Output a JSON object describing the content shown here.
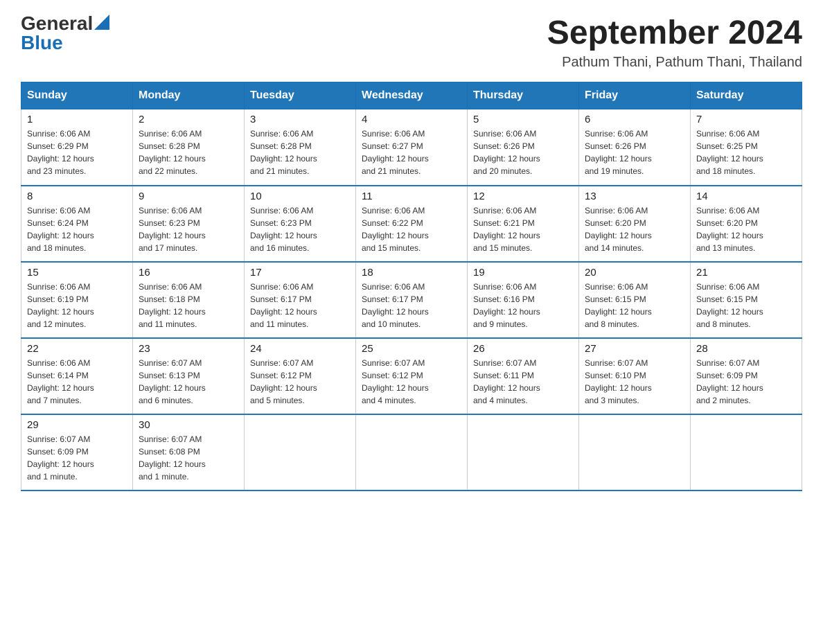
{
  "header": {
    "logo_general": "General",
    "logo_blue": "Blue",
    "month_year": "September 2024",
    "location": "Pathum Thani, Pathum Thani, Thailand"
  },
  "days_of_week": [
    "Sunday",
    "Monday",
    "Tuesday",
    "Wednesday",
    "Thursday",
    "Friday",
    "Saturday"
  ],
  "weeks": [
    [
      {
        "day": "1",
        "sunrise": "6:06 AM",
        "sunset": "6:29 PM",
        "daylight": "12 hours and 23 minutes."
      },
      {
        "day": "2",
        "sunrise": "6:06 AM",
        "sunset": "6:28 PM",
        "daylight": "12 hours and 22 minutes."
      },
      {
        "day": "3",
        "sunrise": "6:06 AM",
        "sunset": "6:28 PM",
        "daylight": "12 hours and 21 minutes."
      },
      {
        "day": "4",
        "sunrise": "6:06 AM",
        "sunset": "6:27 PM",
        "daylight": "12 hours and 21 minutes."
      },
      {
        "day": "5",
        "sunrise": "6:06 AM",
        "sunset": "6:26 PM",
        "daylight": "12 hours and 20 minutes."
      },
      {
        "day": "6",
        "sunrise": "6:06 AM",
        "sunset": "6:26 PM",
        "daylight": "12 hours and 19 minutes."
      },
      {
        "day": "7",
        "sunrise": "6:06 AM",
        "sunset": "6:25 PM",
        "daylight": "12 hours and 18 minutes."
      }
    ],
    [
      {
        "day": "8",
        "sunrise": "6:06 AM",
        "sunset": "6:24 PM",
        "daylight": "12 hours and 18 minutes."
      },
      {
        "day": "9",
        "sunrise": "6:06 AM",
        "sunset": "6:23 PM",
        "daylight": "12 hours and 17 minutes."
      },
      {
        "day": "10",
        "sunrise": "6:06 AM",
        "sunset": "6:23 PM",
        "daylight": "12 hours and 16 minutes."
      },
      {
        "day": "11",
        "sunrise": "6:06 AM",
        "sunset": "6:22 PM",
        "daylight": "12 hours and 15 minutes."
      },
      {
        "day": "12",
        "sunrise": "6:06 AM",
        "sunset": "6:21 PM",
        "daylight": "12 hours and 15 minutes."
      },
      {
        "day": "13",
        "sunrise": "6:06 AM",
        "sunset": "6:20 PM",
        "daylight": "12 hours and 14 minutes."
      },
      {
        "day": "14",
        "sunrise": "6:06 AM",
        "sunset": "6:20 PM",
        "daylight": "12 hours and 13 minutes."
      }
    ],
    [
      {
        "day": "15",
        "sunrise": "6:06 AM",
        "sunset": "6:19 PM",
        "daylight": "12 hours and 12 minutes."
      },
      {
        "day": "16",
        "sunrise": "6:06 AM",
        "sunset": "6:18 PM",
        "daylight": "12 hours and 11 minutes."
      },
      {
        "day": "17",
        "sunrise": "6:06 AM",
        "sunset": "6:17 PM",
        "daylight": "12 hours and 11 minutes."
      },
      {
        "day": "18",
        "sunrise": "6:06 AM",
        "sunset": "6:17 PM",
        "daylight": "12 hours and 10 minutes."
      },
      {
        "day": "19",
        "sunrise": "6:06 AM",
        "sunset": "6:16 PM",
        "daylight": "12 hours and 9 minutes."
      },
      {
        "day": "20",
        "sunrise": "6:06 AM",
        "sunset": "6:15 PM",
        "daylight": "12 hours and 8 minutes."
      },
      {
        "day": "21",
        "sunrise": "6:06 AM",
        "sunset": "6:15 PM",
        "daylight": "12 hours and 8 minutes."
      }
    ],
    [
      {
        "day": "22",
        "sunrise": "6:06 AM",
        "sunset": "6:14 PM",
        "daylight": "12 hours and 7 minutes."
      },
      {
        "day": "23",
        "sunrise": "6:07 AM",
        "sunset": "6:13 PM",
        "daylight": "12 hours and 6 minutes."
      },
      {
        "day": "24",
        "sunrise": "6:07 AM",
        "sunset": "6:12 PM",
        "daylight": "12 hours and 5 minutes."
      },
      {
        "day": "25",
        "sunrise": "6:07 AM",
        "sunset": "6:12 PM",
        "daylight": "12 hours and 4 minutes."
      },
      {
        "day": "26",
        "sunrise": "6:07 AM",
        "sunset": "6:11 PM",
        "daylight": "12 hours and 4 minutes."
      },
      {
        "day": "27",
        "sunrise": "6:07 AM",
        "sunset": "6:10 PM",
        "daylight": "12 hours and 3 minutes."
      },
      {
        "day": "28",
        "sunrise": "6:07 AM",
        "sunset": "6:09 PM",
        "daylight": "12 hours and 2 minutes."
      }
    ],
    [
      {
        "day": "29",
        "sunrise": "6:07 AM",
        "sunset": "6:09 PM",
        "daylight": "12 hours and 1 minute."
      },
      {
        "day": "30",
        "sunrise": "6:07 AM",
        "sunset": "6:08 PM",
        "daylight": "12 hours and 1 minute."
      },
      null,
      null,
      null,
      null,
      null
    ]
  ],
  "labels": {
    "sunrise": "Sunrise:",
    "sunset": "Sunset:",
    "daylight": "Daylight:"
  }
}
